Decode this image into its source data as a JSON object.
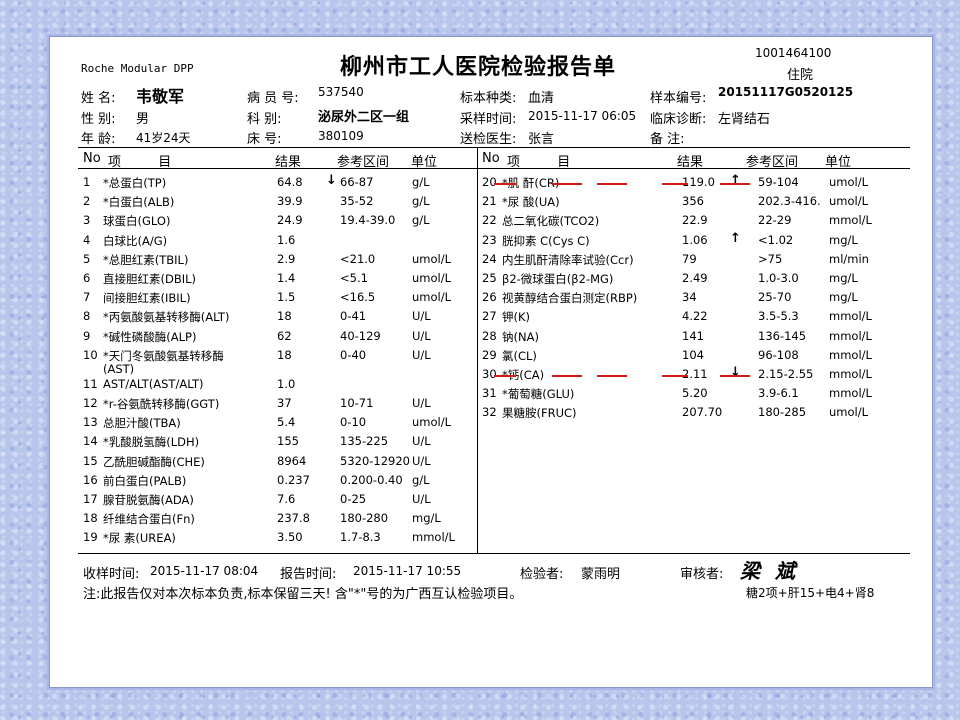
{
  "header": {
    "instrument": "Roche Modular DPP",
    "hospital_title": "柳州市工人医院检验报告单",
    "report_id": "1001464100",
    "admission_type": "住院"
  },
  "patient": {
    "name_label": "姓  名:",
    "name": "韦敬军",
    "sex_label": "性  别:",
    "sex": "男",
    "age_label": "年  龄:",
    "age": "41岁24天",
    "record_label": "病 员 号:",
    "record_no": "537540",
    "dept_label": "科    别:",
    "dept": "泌尿外二区一组",
    "bed_label": "床    号:",
    "bed": "380109",
    "specimen_type_label": "标本种类:",
    "specimen_type": "血清",
    "collect_time_label": "采样时间:",
    "collect_time": "2015-11-17 06:05",
    "doctor_label": "送检医生:",
    "doctor": "张言",
    "sample_no_label": "样本编号:",
    "sample_no": "20151117G0520125",
    "diagnosis_label": "临床诊断:",
    "diagnosis": "左肾结石",
    "remark_label": "备    注:"
  },
  "columns": {
    "no": "No",
    "item": "项         目",
    "result": "结果",
    "ref": "参考区间",
    "unit": "单位"
  },
  "left_rows": [
    {
      "no": "1",
      "item": "*总蛋白(TP)",
      "result": "64.8",
      "flag": "↓",
      "ref": "66-87",
      "unit": "g/L"
    },
    {
      "no": "2",
      "item": "*白蛋白(ALB)",
      "result": "39.9",
      "flag": "",
      "ref": "35-52",
      "unit": "g/L"
    },
    {
      "no": "3",
      "item": "球蛋白(GLO)",
      "result": "24.9",
      "flag": "",
      "ref": "19.4-39.0",
      "unit": "g/L"
    },
    {
      "no": "4",
      "item": "白球比(A/G)",
      "result": "1.6",
      "flag": "",
      "ref": "",
      "unit": ""
    },
    {
      "no": "5",
      "item": "*总胆红素(TBIL)",
      "result": "2.9",
      "flag": "",
      "ref": "<21.0",
      "unit": "umol/L"
    },
    {
      "no": "6",
      "item": "直接胆红素(DBIL)",
      "result": "1.4",
      "flag": "",
      "ref": "<5.1",
      "unit": "umol/L"
    },
    {
      "no": "7",
      "item": "间接胆红素(IBIL)",
      "result": "1.5",
      "flag": "",
      "ref": "<16.5",
      "unit": "umol/L"
    },
    {
      "no": "8",
      "item": "*丙氨酸氨基转移酶(ALT)",
      "result": "18",
      "flag": "",
      "ref": "0-41",
      "unit": "U/L"
    },
    {
      "no": "9",
      "item": "*碱性磷酸酶(ALP)",
      "result": "62",
      "flag": "",
      "ref": "40-129",
      "unit": "U/L"
    },
    {
      "no": "10",
      "item": "*天门冬氨酸氨基转移酶",
      "item2": "(AST)",
      "result": "18",
      "flag": "",
      "ref": "0-40",
      "unit": "U/L"
    },
    {
      "no": "11",
      "item": "AST/ALT(AST/ALT)",
      "result": "1.0",
      "flag": "",
      "ref": "",
      "unit": ""
    },
    {
      "no": "12",
      "item": "*r-谷氨酰转移酶(GGT)",
      "result": "37",
      "flag": "",
      "ref": "10-71",
      "unit": "U/L"
    },
    {
      "no": "13",
      "item": "总胆汁酸(TBA)",
      "result": "5.4",
      "flag": "",
      "ref": "0-10",
      "unit": "umol/L"
    },
    {
      "no": "14",
      "item": "*乳酸脱氢酶(LDH)",
      "result": "155",
      "flag": "",
      "ref": "135-225",
      "unit": "U/L"
    },
    {
      "no": "15",
      "item": "乙酰胆碱酯酶(CHE)",
      "result": "8964",
      "flag": "",
      "ref": "5320-12920",
      "unit": "U/L"
    },
    {
      "no": "16",
      "item": "前白蛋白(PALB)",
      "result": "0.237",
      "flag": "",
      "ref": "0.200-0.40",
      "unit": "g/L"
    },
    {
      "no": "17",
      "item": "腺苷脱氨酶(ADA)",
      "result": "7.6",
      "flag": "",
      "ref": "0-25",
      "unit": "U/L"
    },
    {
      "no": "18",
      "item": "纤维结合蛋白(Fn)",
      "result": "237.8",
      "flag": "",
      "ref": "180-280",
      "unit": "mg/L"
    },
    {
      "no": "19",
      "item": "*尿  素(UREA)",
      "result": "3.50",
      "flag": "",
      "ref": "1.7-8.3",
      "unit": "mmol/L"
    }
  ],
  "right_rows": [
    {
      "no": "20",
      "item": "*肌  酐(CR)",
      "result": "119.0",
      "flag": "↑",
      "ref": "59-104",
      "unit": "umol/L",
      "struck": true
    },
    {
      "no": "21",
      "item": "*尿  酸(UA)",
      "result": "356",
      "flag": "",
      "ref": "202.3-416.",
      "unit": "umol/L"
    },
    {
      "no": "22",
      "item": "总二氧化碳(TCO2)",
      "result": "22.9",
      "flag": "",
      "ref": "22-29",
      "unit": "mmol/L"
    },
    {
      "no": "23",
      "item": "胱抑素 C(Cys C)",
      "result": "1.06",
      "flag": "↑",
      "ref": "<1.02",
      "unit": "mg/L"
    },
    {
      "no": "24",
      "item": "内生肌酐清除率试验(Ccr)",
      "result": "79",
      "flag": "",
      "ref": ">75",
      "unit": "ml/min"
    },
    {
      "no": "25",
      "item": "β2-微球蛋白(β2-MG)",
      "result": "2.49",
      "flag": "",
      "ref": "1.0-3.0",
      "unit": "mg/L"
    },
    {
      "no": "26",
      "item": "视黄醇结合蛋白测定(RBP)",
      "result": "34",
      "flag": "",
      "ref": "25-70",
      "unit": "mg/L"
    },
    {
      "no": "27",
      "item": "钾(K)",
      "result": "4.22",
      "flag": "",
      "ref": "3.5-5.3",
      "unit": "mmol/L"
    },
    {
      "no": "28",
      "item": "钠(NA)",
      "result": "141",
      "flag": "",
      "ref": "136-145",
      "unit": "mmol/L"
    },
    {
      "no": "29",
      "item": "氯(CL)",
      "result": "104",
      "flag": "",
      "ref": "96-108",
      "unit": "mmol/L"
    },
    {
      "no": "30",
      "item": "*钙(CA)",
      "result": "2.11",
      "flag": "↓",
      "ref": "2.15-2.55",
      "unit": "mmol/L",
      "struck": true
    },
    {
      "no": "31",
      "item": "*葡萄糖(GLU)",
      "result": "5.20",
      "flag": "",
      "ref": "3.9-6.1",
      "unit": "mmol/L"
    },
    {
      "no": "32",
      "item": "果糖胺(FRUC)",
      "result": "207.70",
      "flag": "",
      "ref": "180-285",
      "unit": "umol/L"
    }
  ],
  "footer": {
    "receive_label": "收样时间:",
    "receive_time": "2015-11-17 08:04",
    "report_label": "报告时间:",
    "report_time": "2015-11-17 10:55",
    "tester_label": "检验者:",
    "tester": "蒙雨明",
    "reviewer_label": "审核者:",
    "reviewer_signature": "梁  斌",
    "note": "注:此报告仅对本次标本负责,标本保留三天! 含\"*\"号的为广西互认检验项目。",
    "package": "糖2项+肝15+电4+肾8"
  },
  "colors": {
    "background": "#b9c6ec",
    "paper": "#ffffff",
    "strike": "#d11a1a"
  }
}
